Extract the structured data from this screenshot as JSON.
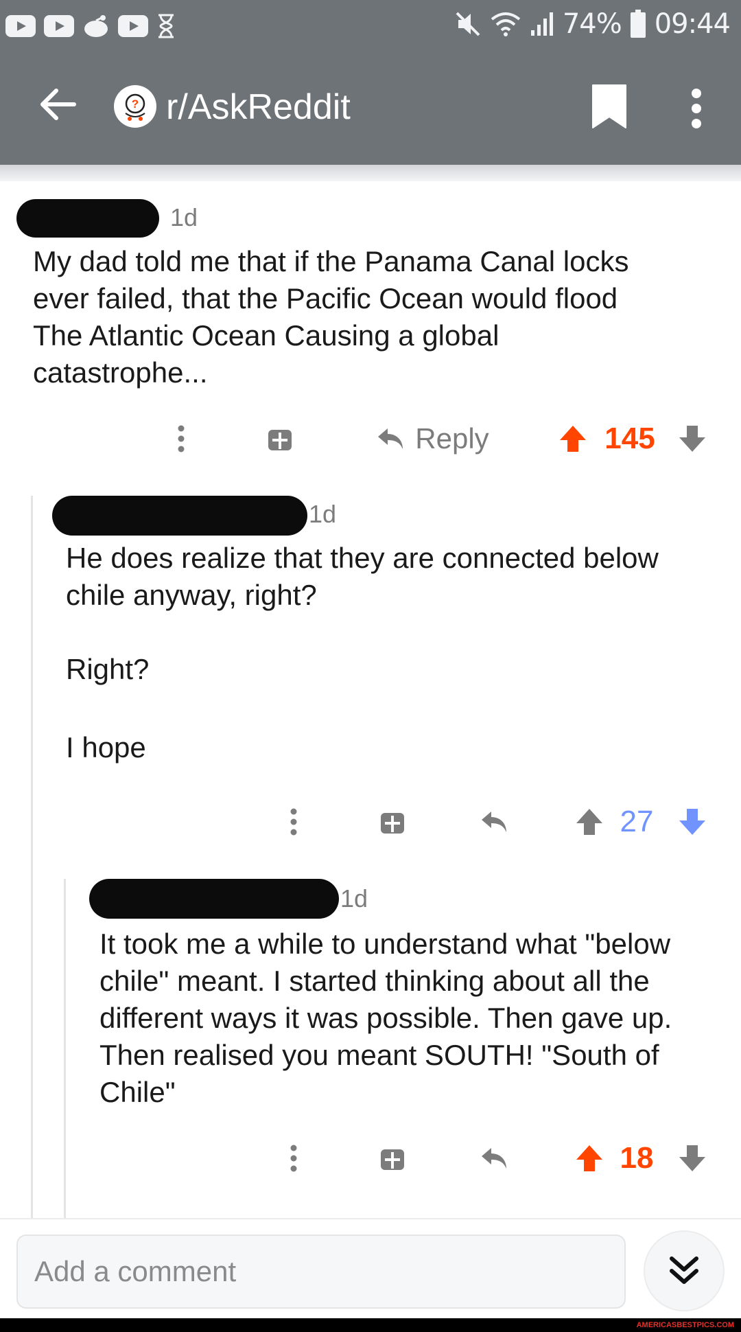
{
  "status_bar": {
    "battery": "74%",
    "time": "09:44"
  },
  "app_bar": {
    "subreddit": "r/AskReddit"
  },
  "comments": [
    {
      "author": "",
      "age": "1d",
      "body": [
        "My dad told me that if the Panama Canal locks ever failed, that the Pacific Ocean would flood The Atlantic Ocean Causing a global catastrophe..."
      ],
      "reply_label": "Reply",
      "score": "145",
      "vote": "up"
    },
    {
      "author": "",
      "age": "1d",
      "body": [
        "He does realize that they are connected below chile anyway, right?",
        "Right?",
        "I hope"
      ],
      "score": "27",
      "vote": "down"
    },
    {
      "author": "",
      "age": "1d",
      "body": [
        "It took me a while to understand what \"below chile\" meant. I started thinking about all the different ways it was possible. Then gave up. Then realised you meant SOUTH! \"South of Chile\""
      ],
      "score": "18",
      "vote": "up"
    }
  ],
  "composer": {
    "placeholder": "Add a comment"
  },
  "watermark": "AMERICASBESTPICS.COM",
  "colors": {
    "header": "#6e7378",
    "upvote": "#ff4500",
    "downvote": "#7193ff",
    "neutral": "#7c7c7c"
  },
  "icons": {
    "back": "arrow-left-icon",
    "bookmark": "bookmark-icon",
    "more": "more-vertical-icon",
    "gift": "gift-icon",
    "reply": "reply-icon",
    "upvote": "upvote-arrow-icon",
    "downvote": "downvote-arrow-icon",
    "jump": "chevron-double-down-icon"
  }
}
